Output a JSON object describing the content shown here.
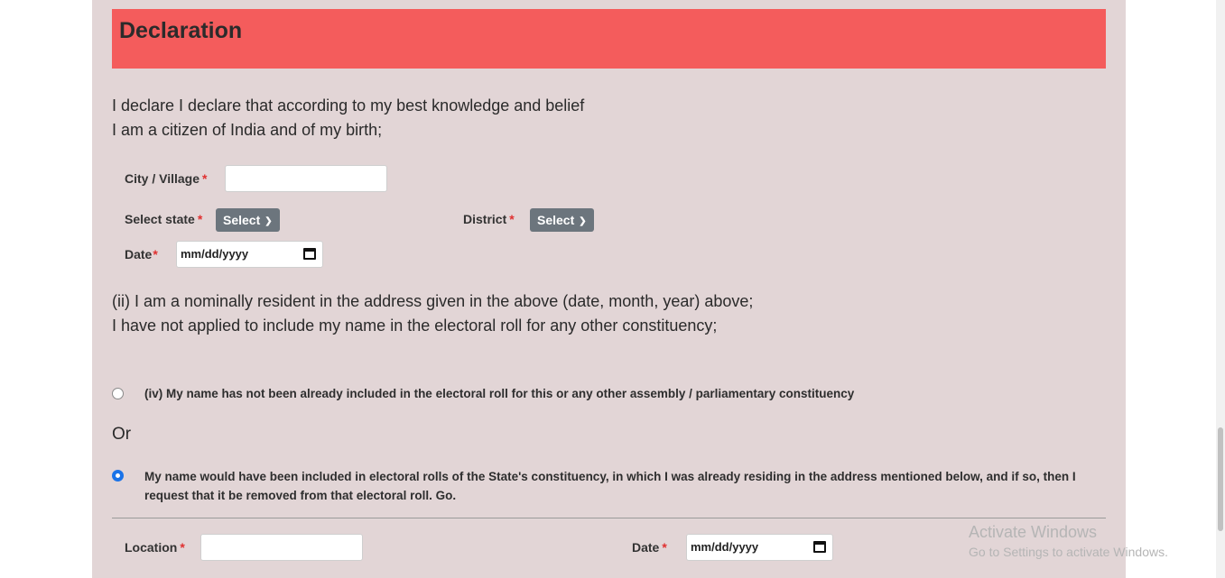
{
  "header": {
    "title": "Declaration"
  },
  "intro": {
    "line1": "I declare I declare that according to my best knowledge and belief",
    "line2": "I am a citizen of India and of my birth;"
  },
  "form": {
    "city_label": "City / Village",
    "state_label": "Select state",
    "state_value": "Select",
    "district_label": "District",
    "district_value": "Select",
    "date_label": "Date",
    "date_placeholder": "mm/dd/yyyy",
    "required_mark": "*"
  },
  "resident": {
    "line1": "(ii) I am a nominally resident in the address given in the above (date, month, year) above;",
    "line2": "I have not applied to include my name in the electoral roll for any other constituency;"
  },
  "options": {
    "option1": "(iv) My name has not been already included in the electoral roll for this or any other assembly / parliamentary constituency",
    "or_label": "Or",
    "option2_line1": "My name would have been included in electoral rolls of the State's constituency, in which I was already residing in the address mentioned below, and if so, then I",
    "option2_line2": "request that it be removed from that electoral roll. Go.",
    "selected": "option2"
  },
  "bottom": {
    "location_label": "Location",
    "date_label": "Date",
    "date_placeholder": "mm/dd/yyyy"
  },
  "watermark": {
    "title": "Activate Windows",
    "subtitle": "Go to Settings to activate Windows."
  }
}
